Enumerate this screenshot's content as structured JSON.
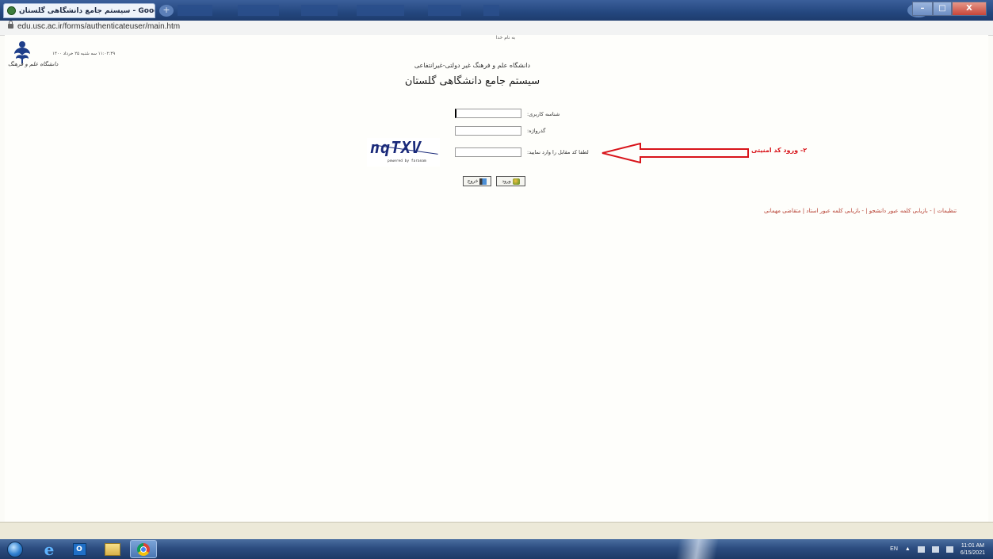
{
  "window": {
    "tab_title": "سیستم جامع دانشگاهی گلستان - Google Chrome",
    "url": "edu.usc.ac.ir/forms/authenticateuser/main.htm"
  },
  "page": {
    "bismillah": "به نام خدا",
    "logo_text": "دانشگاه علم و فرهنگ",
    "datetime": "۱۱:۰۲:۴۹ سه شنبه ۲۵ خرداد ۱۴۰۰",
    "subtitle": "دانشگاه علم و فرهنگ غیر دولتی-غیرانتفاعی",
    "title": "سیستم جامع دانشگاهی گلستان",
    "username_label": "شناسه کاربری:",
    "password_label": "گذرواژه:",
    "captcha_label": "لطفا کد مقابل را وارد نمایید:",
    "captcha_text": "nqTXV",
    "captcha_credit": "powered by faranam",
    "annotation": "۲- ورود کد امنیتی",
    "login_button": "ورود",
    "exit_button": "خروج",
    "links": "تنظیمات | - بازیابی کلمه عبور دانشجو | - بازیابی کلمه عبور استاد | متقاضی مهمانی",
    "annotation_color": "#d8141a"
  },
  "taskbar": {
    "items": [
      "start-orb",
      "internet-explorer",
      "outlook",
      "windows-explorer",
      "google-chrome"
    ],
    "language": "EN",
    "time": "11:01 AM",
    "date": "6/15/2021"
  }
}
